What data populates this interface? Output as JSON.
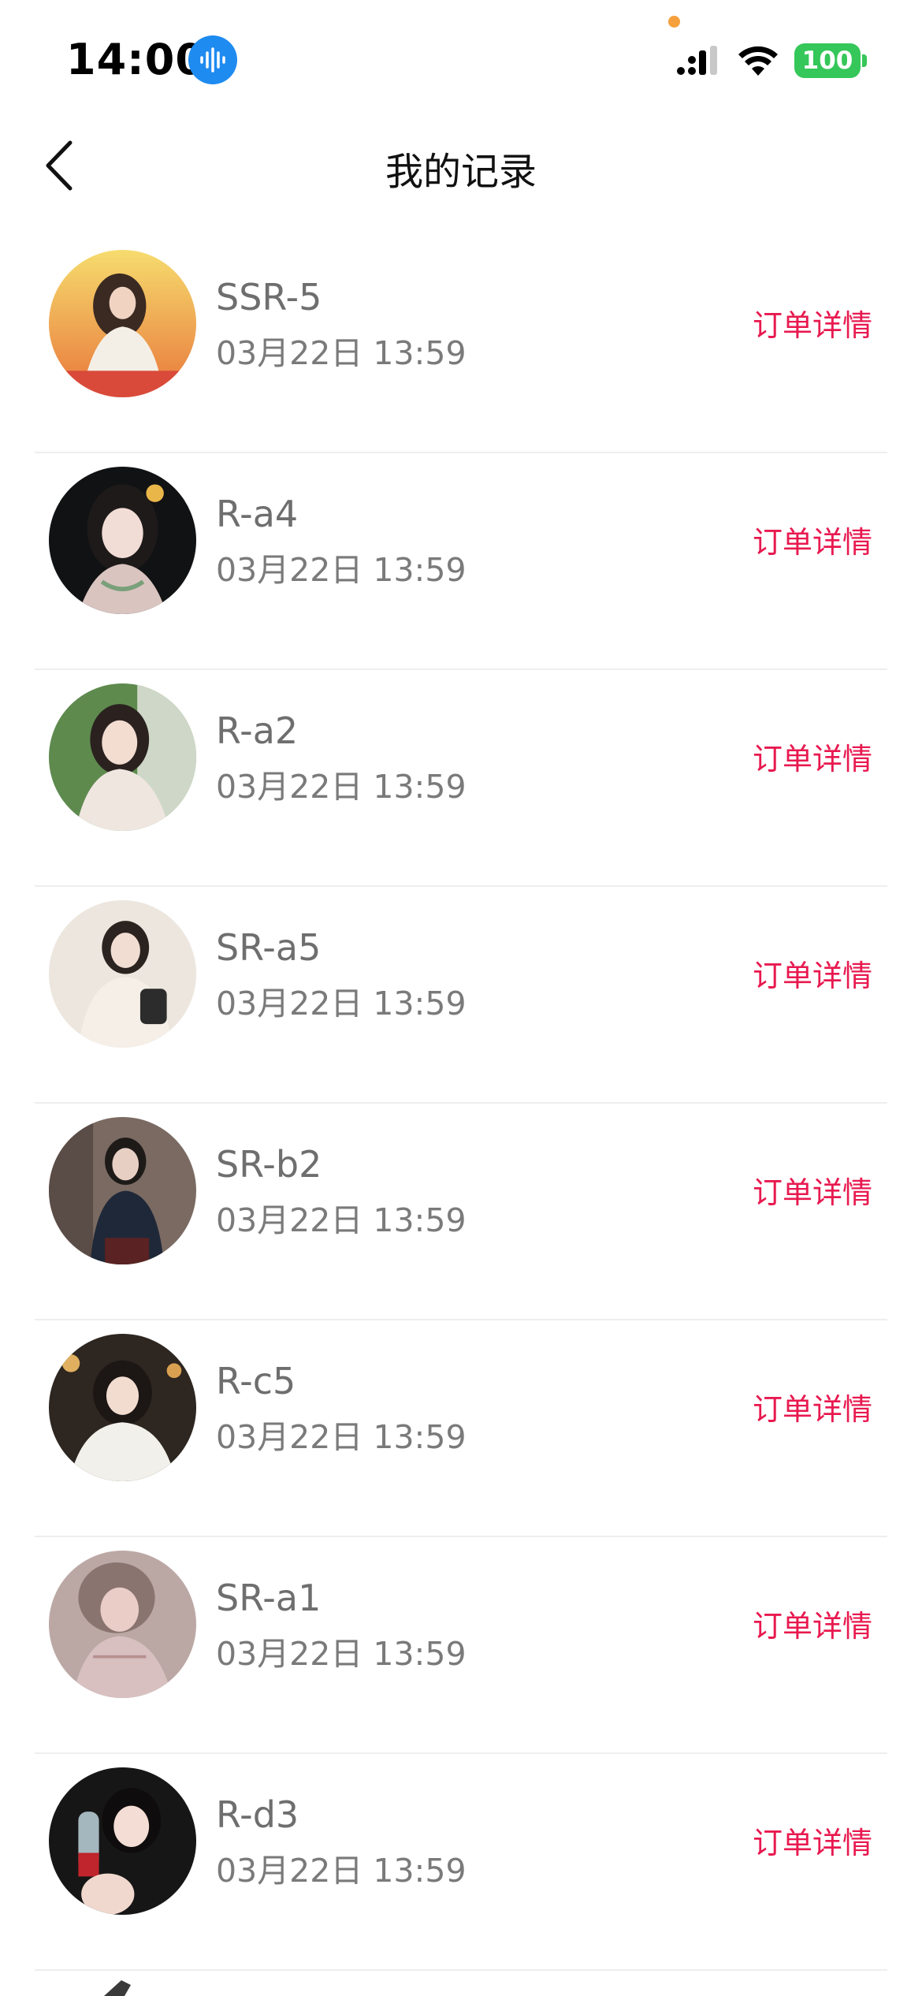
{
  "status_bar": {
    "time": "14:00",
    "battery": "100",
    "icons": [
      "voice-assistant-icon",
      "signal-icon",
      "wifi-icon",
      "battery-icon"
    ],
    "battery_color": "#35c759",
    "dot_color": "#f5a03c"
  },
  "header": {
    "back_icon": "chevron-left-icon",
    "title": "我的记录"
  },
  "accent_color": "#e8194f",
  "records": [
    {
      "name": "SSR-5",
      "time": "03月22日 13:59",
      "action": "订单详情"
    },
    {
      "name": "R-a4",
      "time": "03月22日 13:59",
      "action": "订单详情"
    },
    {
      "name": "R-a2",
      "time": "03月22日 13:59",
      "action": "订单详情"
    },
    {
      "name": "SR-a5",
      "time": "03月22日 13:59",
      "action": "订单详情"
    },
    {
      "name": "SR-b2",
      "time": "03月22日 13:59",
      "action": "订单详情"
    },
    {
      "name": "R-c5",
      "time": "03月22日 13:59",
      "action": "订单详情"
    },
    {
      "name": "SR-a1",
      "time": "03月22日 13:59",
      "action": "订单详情"
    },
    {
      "name": "R-d3",
      "time": "03月22日 13:59",
      "action": "订单详情"
    }
  ]
}
